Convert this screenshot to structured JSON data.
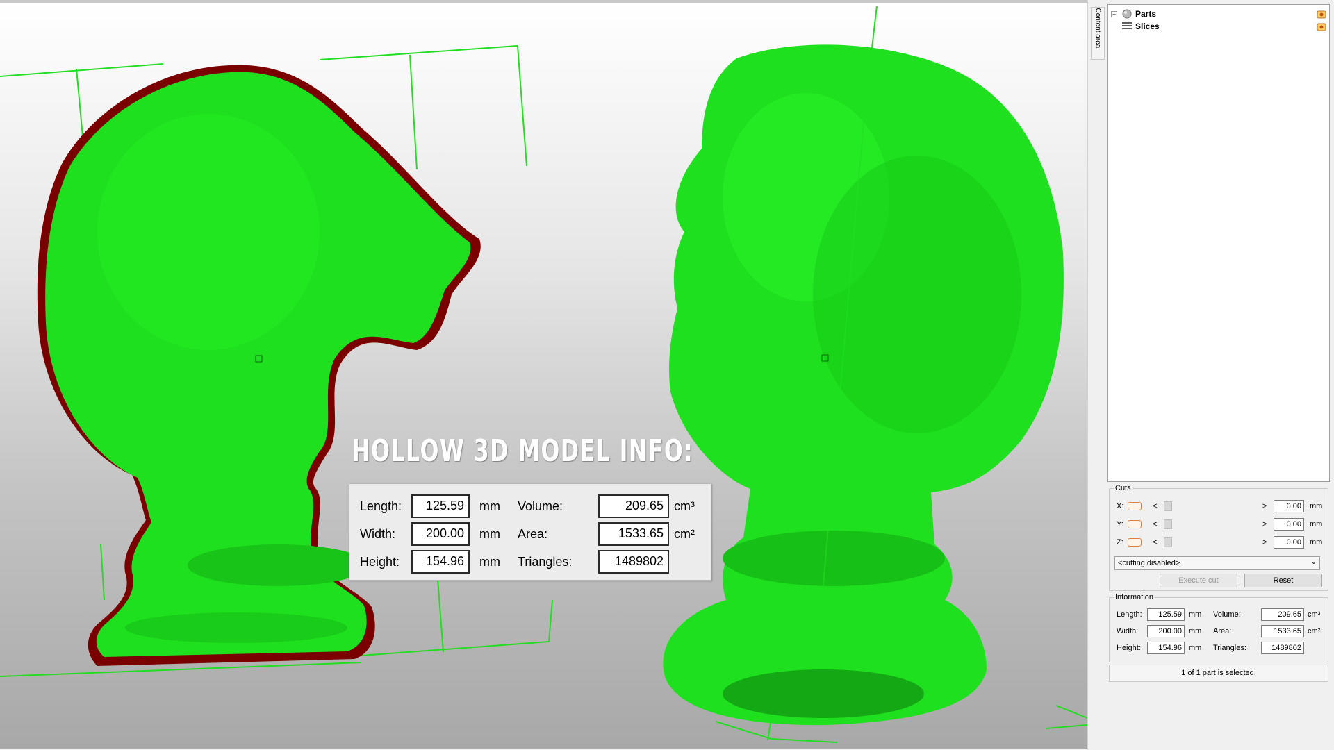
{
  "viewport": {
    "overlay_title": "HOLLOW 3D MODEL INFO:",
    "overlay": {
      "length_label": "Length:",
      "length_value": "125.59",
      "length_unit": "mm",
      "width_label": "Width:",
      "width_value": "200.00",
      "width_unit": "mm",
      "height_label": "Height:",
      "height_value": "154.96",
      "height_unit": "mm",
      "volume_label": "Volume:",
      "volume_value": "209.65",
      "volume_unit": "cm³",
      "area_label": "Area:",
      "area_value": "1533.65",
      "area_unit": "cm²",
      "triangles_label": "Triangles:",
      "triangles_value": "1489802"
    },
    "model_color": "#1ee01e",
    "cut_edge_color": "#7a0000"
  },
  "splitter": {
    "tab_label": "Content area"
  },
  "tree": {
    "items": [
      {
        "label": "Parts",
        "expander": "+"
      },
      {
        "label": "Slices"
      }
    ]
  },
  "cuts": {
    "legend": "Cuts",
    "rows": [
      {
        "axis": "X:",
        "value": "0.00",
        "unit": "mm"
      },
      {
        "axis": "Y:",
        "value": "0.00",
        "unit": "mm"
      },
      {
        "axis": "Z:",
        "value": "0.00",
        "unit": "mm"
      }
    ],
    "left_arrow": "<",
    "right_arrow": ">",
    "mode": "<cutting disabled>",
    "execute_label": "Execute cut",
    "reset_label": "Reset"
  },
  "information": {
    "legend": "Information",
    "length_label": "Length:",
    "length_value": "125.59",
    "length_unit": "mm",
    "width_label": "Width:",
    "width_value": "200.00",
    "width_unit": "mm",
    "height_label": "Height:",
    "height_value": "154.96",
    "height_unit": "mm",
    "volume_label": "Volume:",
    "volume_value": "209.65",
    "volume_unit": "cm³",
    "area_label": "Area:",
    "area_value": "1533.65",
    "area_unit": "cm²",
    "triangles_label": "Triangles:",
    "triangles_value": "1489802"
  },
  "status": {
    "selection_text": "1 of 1 part is selected."
  }
}
